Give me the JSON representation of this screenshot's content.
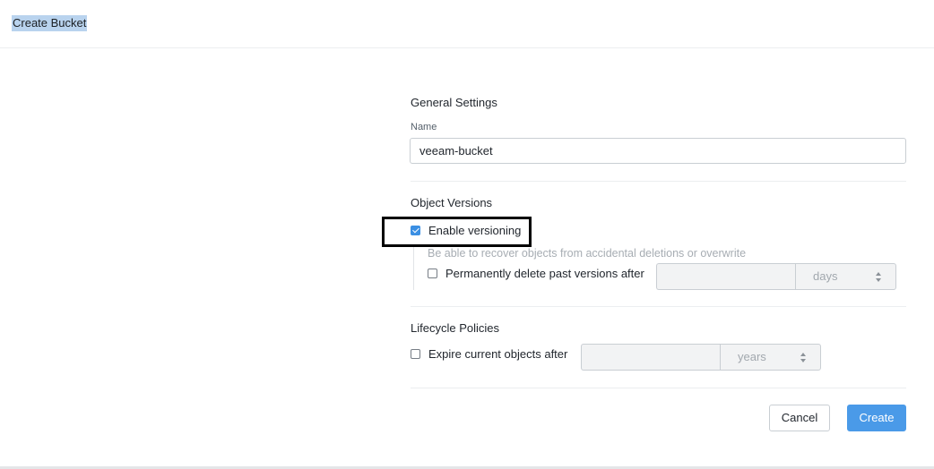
{
  "header": {
    "title": "Create Bucket"
  },
  "general": {
    "title": "General Settings",
    "name_label": "Name",
    "name_value": "veeam-bucket"
  },
  "versions": {
    "title": "Object Versions",
    "enable_label": "Enable versioning",
    "enable_checked": true,
    "helper": "Be able to recover objects from accidental deletions or overwrite",
    "delete_label": "Permanently delete past versions after",
    "delete_checked": false,
    "delete_value": "",
    "delete_unit": "days"
  },
  "lifecycle": {
    "title": "Lifecycle Policies",
    "expire_label": "Expire current objects after",
    "expire_checked": false,
    "expire_value": "",
    "expire_unit": "years"
  },
  "actions": {
    "cancel": "Cancel",
    "create": "Create"
  },
  "colors": {
    "accent": "#4a9ae8",
    "title_highlight": "#b9d3ee"
  }
}
